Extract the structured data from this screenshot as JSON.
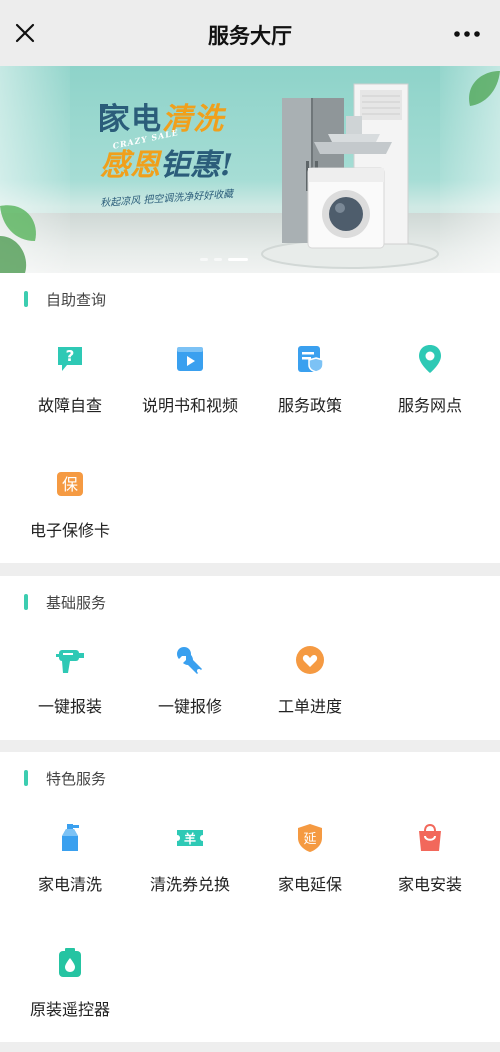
{
  "navbar": {
    "title": "服务大厅"
  },
  "banner": {
    "line1_a": "家电",
    "line1_b": "清洗",
    "crazy_sale": "CRAZY SALE",
    "line2_a": "感恩",
    "line2_b": "钜惠!",
    "subtitle": "秋起凉风 把空调洗净好好收藏"
  },
  "sections": [
    {
      "title": "自助查询",
      "items": [
        {
          "label": "故障自查",
          "icon": "question-bubble-icon"
        },
        {
          "label": "说明书和视频",
          "icon": "video-icon"
        },
        {
          "label": "服务政策",
          "icon": "policy-shield-icon"
        },
        {
          "label": "服务网点",
          "icon": "location-pin-icon"
        },
        {
          "label": "电子保修卡",
          "icon": "warranty-card-icon",
          "icon_text": "保"
        }
      ]
    },
    {
      "title": "基础服务",
      "items": [
        {
          "label": "一键报装",
          "icon": "drill-icon"
        },
        {
          "label": "一键报修",
          "icon": "wrench-icon"
        },
        {
          "label": "工单进度",
          "icon": "heart-circle-icon"
        }
      ]
    },
    {
      "title": "特色服务",
      "items": [
        {
          "label": "家电清洗",
          "icon": "spray-bottle-icon"
        },
        {
          "label": "清洗券兑换",
          "icon": "coupon-icon",
          "icon_text": "羊"
        },
        {
          "label": "家电延保",
          "icon": "extend-shield-icon",
          "icon_text": "延"
        },
        {
          "label": "家电安装",
          "icon": "shopping-bag-icon"
        },
        {
          "label": "原装遥控器",
          "icon": "remote-icon"
        }
      ]
    }
  ],
  "colors": {
    "accent": "#3ccdb0",
    "teal": "#2ec9b5",
    "blue": "#3aa0ef",
    "orange": "#f59a42",
    "red": "#f2685b",
    "green": "#25c4a2"
  }
}
